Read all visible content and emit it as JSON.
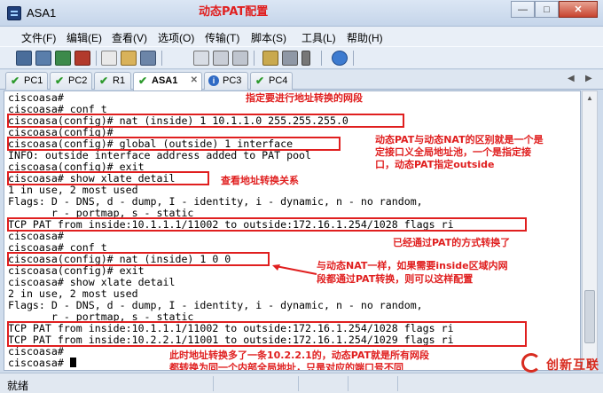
{
  "window": {
    "title": "ASA1"
  },
  "menu": [
    "文件(F)",
    "编辑(E)",
    "查看(V)",
    "选项(O)",
    "传输(T)",
    "脚本(S)",
    "工具(L)",
    "帮助(H)"
  ],
  "toolbar_icons": [
    "connect-icon",
    "quick-connect-icon",
    "reconnect-icon",
    "disconnect-icon",
    "copy-icon",
    "paste-icon",
    "find-icon",
    "print-setup-icon",
    "print-icon",
    "session-options-icon",
    "global-options-icon",
    "keymap-icon",
    "help-icon"
  ],
  "tabs": [
    {
      "label": "PC1",
      "status": "connected",
      "active": false
    },
    {
      "label": "PC2",
      "status": "connected",
      "active": false
    },
    {
      "label": "R1",
      "status": "connected",
      "active": false
    },
    {
      "label": "ASA1",
      "status": "connected",
      "active": true
    },
    {
      "label": "PC3",
      "status": "info",
      "active": false
    },
    {
      "label": "PC4",
      "status": "connected",
      "active": false
    }
  ],
  "terminal": {
    "lines": [
      "ciscoasa#",
      "ciscoasa# conf t",
      "ciscoasa(config)# nat (inside) 1 10.1.1.0 255.255.255.0",
      "ciscoasa(config)#",
      "ciscoasa(config)# global (outside) 1 interface",
      "INFO: outside interface address added to PAT pool",
      "ciscoasa(config)# exit",
      "ciscoasa# show xlate detail",
      "1 in use, 2 most used",
      "Flags: D - DNS, d - dump, I - identity, i - dynamic, n - no random,",
      "       r - portmap, s - static",
      "TCP PAT from inside:10.1.1.1/11002 to outside:172.16.1.254/1028 flags ri",
      "ciscoasa#",
      "ciscoasa# conf t",
      "ciscoasa(config)# nat (inside) 1 0 0",
      "ciscoasa(config)# exit",
      "ciscoasa# show xlate detail",
      "2 in use, 2 most used",
      "Flags: D - DNS, d - dump, I - identity, i - dynamic, n - no random,",
      "       r - portmap, s - static",
      "TCP PAT from inside:10.1.1.1/11002 to outside:172.16.1.254/1028 flags ri",
      "TCP PAT from inside:10.2.2.1/11001 to outside:172.16.1.254/1029 flags ri",
      "ciscoasa#",
      "ciscoasa# "
    ]
  },
  "annotations": {
    "title": "动态PAT配置",
    "nat_network": "指定要进行地址转换的网段",
    "pat_vs_nat_1": "动态PAT与动态NAT的区别就是一个是",
    "pat_vs_nat_2": "定接口义全局地址池，一个是指定接",
    "pat_vs_nat_3": "口，动态PAT指定outside",
    "view_xlate": "查看地址转换关系",
    "converted": "已经通过PAT的方式转换了",
    "all_inside_1": "与动态NAT一样，如果需要inside区域内网",
    "all_inside_2": "段都通过PAT转换，则可以这样配置",
    "summary_1": "此时地址转换多了一条10.2.2.1的，动态PAT就是所有网段",
    "summary_2": "都转换为同一个内部全局地址，只是对应的端口号不同"
  },
  "status": {
    "text": "就绪"
  },
  "watermark": {
    "text": "创新互联"
  }
}
